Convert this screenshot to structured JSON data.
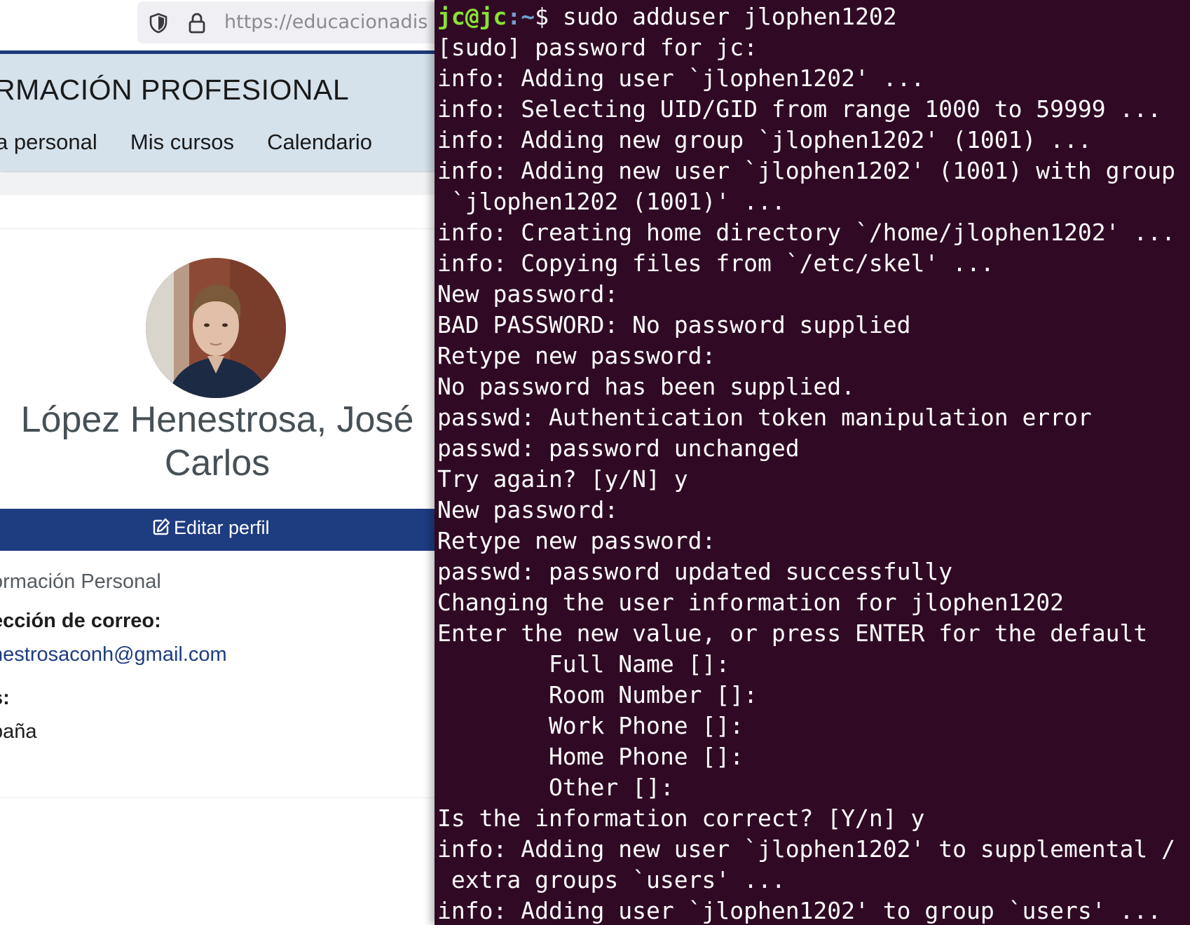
{
  "browser": {
    "url": "https://educacionadis",
    "site_title": "RMACIÓN PROFESIONAL",
    "nav": [
      "a personal",
      "Mis cursos",
      "Calendario"
    ],
    "profile": {
      "name_line1": "López Henestrosa, José",
      "name_line2": "Carlos",
      "edit_label": "Editar perfil",
      "info_heading": "ormación Personal",
      "email_label": "ección de correo:",
      "email_value": "nestrosaconh@gmail.com",
      "country_label": "s:",
      "country_value": "paña"
    }
  },
  "terminal": {
    "prompt_user": "jc@jc",
    "prompt_path": ":~",
    "prompt_symbol": "$ ",
    "command": "sudo adduser jlophen1202",
    "lines": [
      "[sudo] password for jc:",
      "info: Adding user `jlophen1202' ...",
      "info: Selecting UID/GID from range 1000 to 59999 ...",
      "info: Adding new group `jlophen1202' (1001) ...",
      "info: Adding new user `jlophen1202' (1001) with group",
      " `jlophen1202 (1001)' ...",
      "info: Creating home directory `/home/jlophen1202' ...",
      "info: Copying files from `/etc/skel' ...",
      "New password:",
      "BAD PASSWORD: No password supplied",
      "Retype new password:",
      "No password has been supplied.",
      "passwd: Authentication token manipulation error",
      "passwd: password unchanged",
      "Try again? [y/N] y",
      "New password:",
      "Retype new password:",
      "passwd: password updated successfully",
      "Changing the user information for jlophen1202",
      "Enter the new value, or press ENTER for the default",
      "        Full Name []:",
      "        Room Number []:",
      "        Work Phone []:",
      "        Home Phone []:",
      "        Other []:",
      "Is the information correct? [Y/n] y",
      "info: Adding new user `jlophen1202' to supplemental /",
      " extra groups `users' ...",
      "info: Adding user `jlophen1202' to group `users' ..."
    ]
  }
}
